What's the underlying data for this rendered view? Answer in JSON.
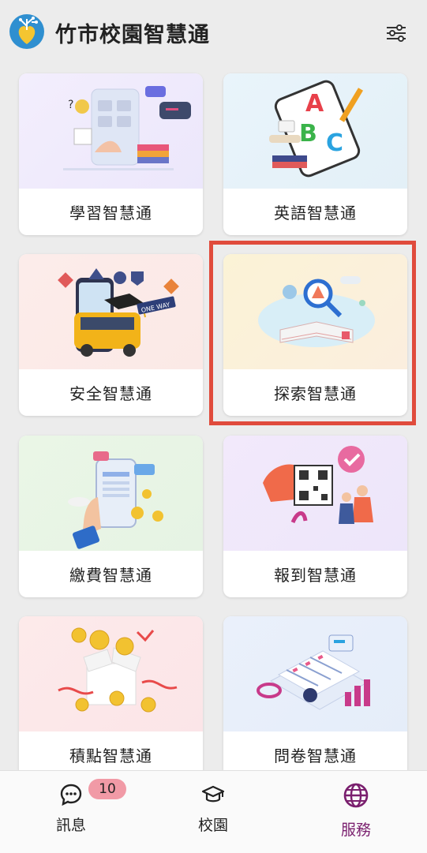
{
  "header": {
    "title": "竹市校園智慧通"
  },
  "cards": [
    {
      "label": "學習智慧通"
    },
    {
      "label": "英語智慧通"
    },
    {
      "label": "安全智慧通"
    },
    {
      "label": "探索智慧通"
    },
    {
      "label": "繳費智慧通"
    },
    {
      "label": "報到智慧通"
    },
    {
      "label": "積點智慧通"
    },
    {
      "label": "問卷智慧通"
    }
  ],
  "tabbar": {
    "messages": {
      "label": "訊息",
      "badge": "10"
    },
    "campus": {
      "label": "校園"
    },
    "services": {
      "label": "服務"
    }
  },
  "colors": {
    "accent": "#7a1f6e",
    "highlight": "#e04b3c",
    "badge": "#f19aa6"
  }
}
